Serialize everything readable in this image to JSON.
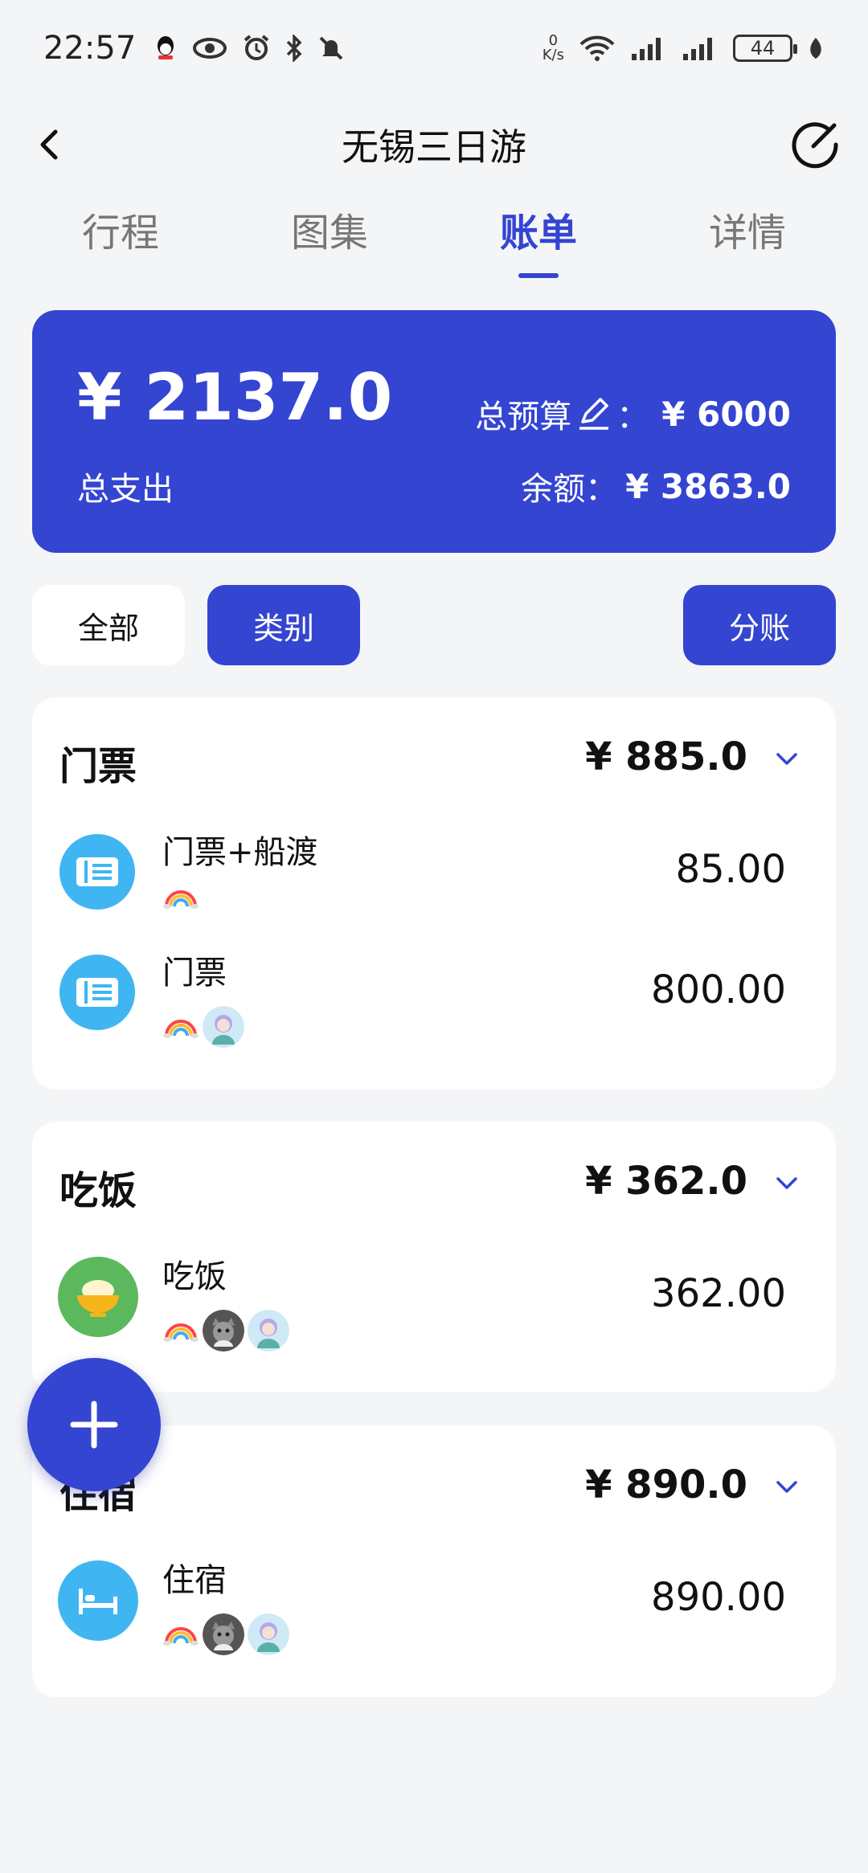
{
  "status": {
    "time": "22:57",
    "netspeed_value": "0",
    "netspeed_unit": "K/s",
    "battery": "44",
    "icons": [
      "qq-icon",
      "eye-icon",
      "alarm-icon",
      "bluetooth-icon",
      "mute-icon",
      "wifi-icon",
      "signal-icon",
      "signal-icon",
      "leaf-icon"
    ]
  },
  "nav": {
    "title": "无锡三日游"
  },
  "tabs": [
    {
      "label": "行程",
      "active": false
    },
    {
      "label": "图集",
      "active": false
    },
    {
      "label": "账单",
      "active": true
    },
    {
      "label": "详情",
      "active": false
    }
  ],
  "summary": {
    "total": "¥ 2137.0",
    "total_label": "总支出",
    "budget_label": "总预算",
    "budget_sep": "：",
    "budget_value": "¥ 6000",
    "balance_label": "余额：",
    "balance_value": "¥ 3863.0"
  },
  "filters": {
    "all": "全部",
    "category": "类别",
    "split": "分账"
  },
  "sections": [
    {
      "title": "门票",
      "total": "¥ 885.0",
      "items": [
        {
          "name": "门票+船渡",
          "amount": "85.00",
          "icon": "ticket-icon"
        },
        {
          "name": "门票",
          "amount": "800.00",
          "icon": "ticket-icon"
        }
      ]
    },
    {
      "title": "吃饭",
      "total": "¥ 362.0",
      "items": [
        {
          "name": "吃饭",
          "amount": "362.00",
          "icon": "rice-bowl-icon"
        }
      ]
    },
    {
      "title": "住宿",
      "total": "¥ 890.0",
      "items": [
        {
          "name": "住宿",
          "amount": "890.00",
          "icon": "bed-icon"
        }
      ]
    }
  ],
  "colors": {
    "accent": "#3445d1",
    "ticket": "#3fb6f2",
    "food": "#5cb85c",
    "bed": "#3fb6f2",
    "background": "#f4f5f7"
  }
}
